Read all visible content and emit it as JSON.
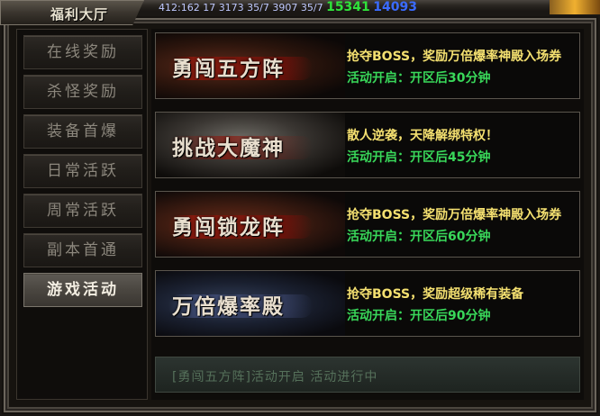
{
  "window": {
    "title": "福利大厅"
  },
  "hud": {
    "coords": "412:162  17  3173  35/7  3907  35/7",
    "green_values": "15341",
    "blue_value": "14093"
  },
  "nav": {
    "items": [
      {
        "label": "在线奖励",
        "active": false
      },
      {
        "label": "杀怪奖励",
        "active": false
      },
      {
        "label": "装备首爆",
        "active": false
      },
      {
        "label": "日常活跃",
        "active": false
      },
      {
        "label": "周常活跃",
        "active": false
      },
      {
        "label": "副本首通",
        "active": false
      },
      {
        "label": "游戏活动",
        "active": true
      }
    ]
  },
  "events": [
    {
      "name": "勇闯五方阵",
      "desc": "抢夺BOSS，奖励万倍爆率神殿入场券",
      "time": "活动开启：开区后30分钟"
    },
    {
      "name": "挑战大魔神",
      "desc": "散人逆袭，天降解绑特权！",
      "time": "活动开启：开区后45分钟"
    },
    {
      "name": "勇闯锁龙阵",
      "desc": "抢夺BOSS，奖励万倍爆率神殿入场券",
      "time": "活动开启：开区后60分钟"
    },
    {
      "name": "万倍爆率殿",
      "desc": "抢夺BOSS，奖励超级稀有装备",
      "time": "活动开启：开区后90分钟"
    }
  ],
  "bottom": {
    "text": "[勇闯五方阵]活动开启 活动进行中"
  },
  "colors": {
    "desc": "#f4e070",
    "time": "#39d85a",
    "nav_active_bg": "#4a4640"
  }
}
